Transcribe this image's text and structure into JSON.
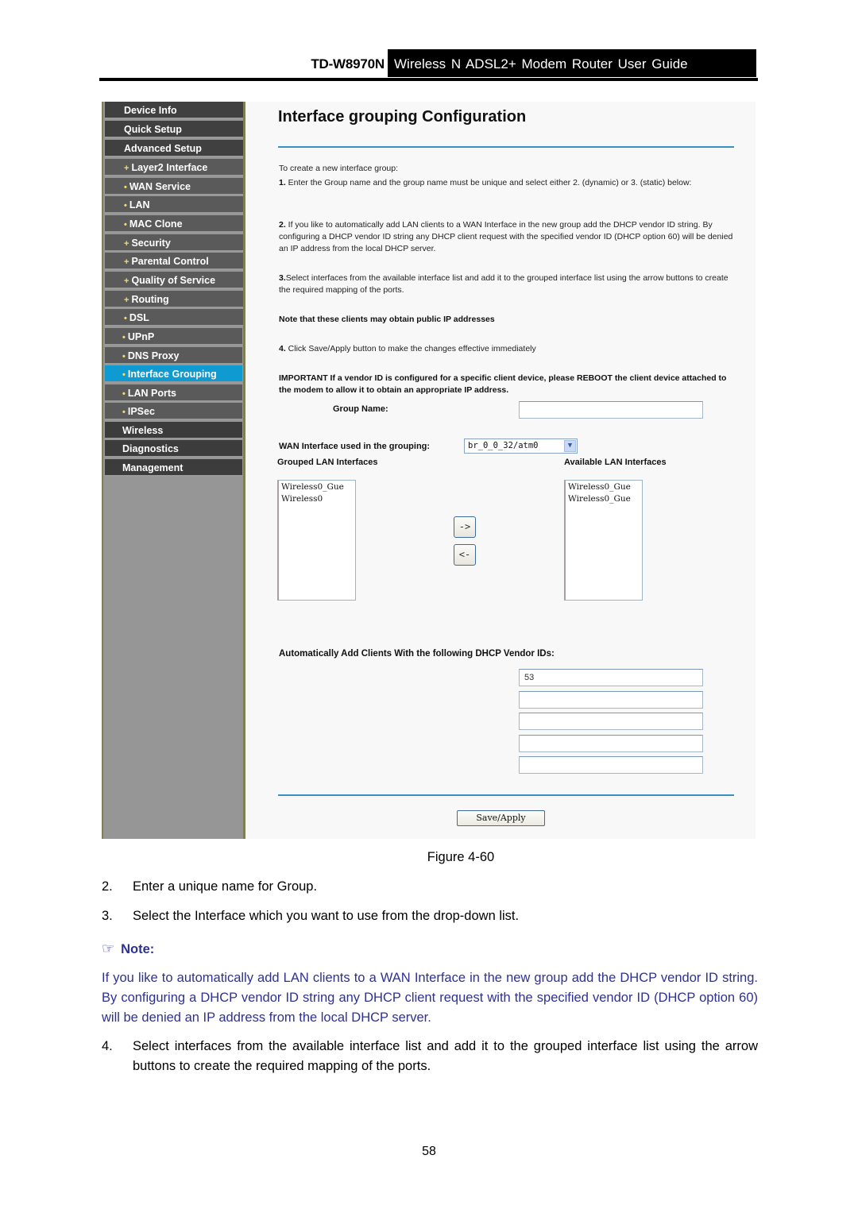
{
  "header": {
    "model": "TD-W8970N",
    "guide_title": "Wireless N ADSL2+ Modem Router User Guide"
  },
  "sidebar": {
    "items": [
      {
        "label": "Device Info",
        "level": "top"
      },
      {
        "label": "Quick Setup",
        "level": "top"
      },
      {
        "label": "Advanced Setup",
        "level": "top"
      },
      {
        "label": "Layer2 Interface",
        "level": "sub",
        "bullet": "+"
      },
      {
        "label": "WAN Service",
        "level": "sub",
        "bullet": "•"
      },
      {
        "label": "LAN",
        "level": "sub",
        "bullet": "•"
      },
      {
        "label": "MAC Clone",
        "level": "sub",
        "bullet": "•"
      },
      {
        "label": "Security",
        "level": "sub",
        "bullet": "+"
      },
      {
        "label": "Parental Control",
        "level": "sub",
        "bullet": "+"
      },
      {
        "label": "Quality of Service",
        "level": "sub",
        "bullet": "+"
      },
      {
        "label": "Routing",
        "level": "sub",
        "bullet": "+"
      },
      {
        "label": "DSL",
        "level": "sub",
        "bullet": "•"
      },
      {
        "label": "UPnP",
        "level": "sub2",
        "bullet": "•"
      },
      {
        "label": "DNS Proxy",
        "level": "sub2",
        "bullet": "•"
      },
      {
        "label": "Interface Grouping",
        "level": "sub2",
        "bullet": "•",
        "active": true
      },
      {
        "label": "LAN Ports",
        "level": "sub2",
        "bullet": "•"
      },
      {
        "label": "IPSec",
        "level": "sub2",
        "bullet": "•"
      },
      {
        "label": "Wireless",
        "level": "main2"
      },
      {
        "label": "Diagnostics",
        "level": "main2"
      },
      {
        "label": "Management",
        "level": "main2"
      }
    ]
  },
  "content": {
    "title": "Interface grouping Configuration",
    "intro": "To create a new interface group:",
    "step1_num": "1.",
    "step1": " Enter the Group name and the group name must be unique and select either 2. (dynamic) or 3. (static) below:",
    "step2_num": "2.",
    "step2": " If you like to automatically add LAN clients to a WAN Interface in the new group add the DHCP vendor ID string. By configuring a DHCP vendor ID string any DHCP client request with the specified vendor ID (DHCP option 60) will be denied an IP address from the local DHCP server.",
    "step3_num": "3.",
    "step3": "Select interfaces from the available interface list and add it to the grouped interface list using the arrow buttons to create the required mapping of the ports.",
    "public_note": "Note that these clients may obtain public IP addresses",
    "step4_num": "4.",
    "step4": " Click Save/Apply button to make the changes effective immediately",
    "important": "IMPORTANT If a vendor ID is configured for a specific client device, please REBOOT the client device attached to the modem to allow it to obtain an appropriate IP address.",
    "group_name_label": "Group Name:",
    "group_name_value": "",
    "wan_label": "WAN Interface used in the grouping:",
    "wan_selected": "br_0_0_32/atm0",
    "grouped_label": "Grouped LAN Interfaces",
    "available_label": "Available LAN Interfaces",
    "grouped_items": [
      "Wireless0_Gue",
      "Wireless0"
    ],
    "available_items": [
      "Wireless0_Gue",
      "Wireless0_Gue"
    ],
    "add_arrow": "->",
    "remove_arrow": "<-",
    "vendor_ids_label": "Automatically Add Clients With the following DHCP Vendor IDs:",
    "vendor_ids": [
      "53",
      "",
      "",
      "",
      ""
    ],
    "save_label": "Save/Apply"
  },
  "doc": {
    "figure_caption": "Figure 4-60",
    "steps": [
      {
        "num": "2.",
        "text": "Enter a unique name for Group."
      },
      {
        "num": "3.",
        "text": "Select the Interface which you want to use from the drop-down list."
      },
      {
        "num": "4.",
        "text": "Select interfaces from the available interface list and add it to the grouped interface list using the arrow buttons to create the required mapping of the ports."
      }
    ],
    "note_icon": "☞",
    "note_label": "Note:",
    "note_text": "If you like to automatically add LAN clients to a WAN Interface in the new group add the DHCP vendor ID string. By configuring a DHCP vendor ID string any DHCP client request with the specified vendor ID (DHCP option 60) will be denied an IP address from the local DHCP server.",
    "page_number": "58"
  },
  "colors": {
    "sidebar_active": "#0f9ad2",
    "divider": "#3b8fc2",
    "note_text": "#2e3192"
  }
}
